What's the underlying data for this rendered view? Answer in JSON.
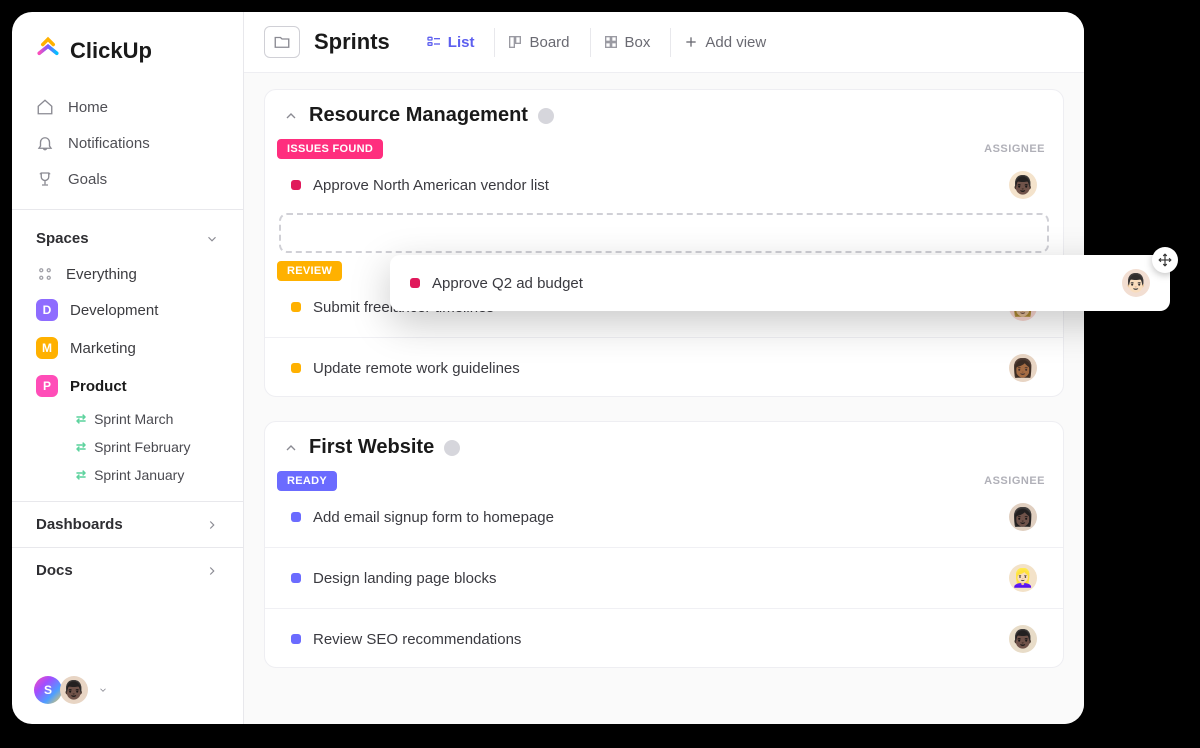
{
  "brand": {
    "name": "ClickUp"
  },
  "nav": {
    "home": "Home",
    "notifications": "Notifications",
    "goals": "Goals"
  },
  "spaces": {
    "header": "Spaces",
    "everything": "Everything",
    "items": [
      {
        "letter": "D",
        "label": "Development",
        "color": "#8e6cff"
      },
      {
        "letter": "M",
        "label": "Marketing",
        "color": "#ffb100"
      },
      {
        "letter": "P",
        "label": "Product",
        "color": "#ff4db8"
      }
    ],
    "sprints": [
      "Sprint  March",
      "Sprint  February",
      "Sprint January"
    ]
  },
  "footer_nav": {
    "dashboards": "Dashboards",
    "docs": "Docs"
  },
  "user": {
    "initial": "S"
  },
  "header": {
    "title": "Sprints",
    "views": {
      "list": "List",
      "board": "Board",
      "box": "Box",
      "add": "Add view"
    }
  },
  "lists": [
    {
      "title": "Resource Management",
      "assignee_label": "ASSIGNEE",
      "groups": [
        {
          "status": "ISSUES FOUND",
          "color": "#ff2e7e",
          "dot": "#e0195b",
          "tasks": [
            {
              "title": "Approve North American vendor list",
              "avatar_bg": "#f4e3cc",
              "avatar_face": "👨🏿"
            }
          ]
        },
        {
          "status": "REVIEW",
          "color": "#ffb100",
          "dot": "#ffb100",
          "tasks": [
            {
              "title": "Submit freelancer timelines",
              "avatar_bg": "#f8d6d0",
              "avatar_face": "👩🏼"
            },
            {
              "title": "Update remote work guidelines",
              "avatar_bg": "#e8d5c4",
              "avatar_face": "👩🏾"
            }
          ]
        }
      ]
    },
    {
      "title": "First Website",
      "assignee_label": "ASSIGNEE",
      "groups": [
        {
          "status": "READY",
          "color": "#6b6bff",
          "dot": "#6b6bff",
          "tasks": [
            {
              "title": "Add email signup form to homepage",
              "avatar_bg": "#e0cfc0",
              "avatar_face": "👩🏿"
            },
            {
              "title": "Design landing page blocks",
              "avatar_bg": "#f3e2c8",
              "avatar_face": "👱🏻‍♀️"
            },
            {
              "title": "Review SEO recommendations",
              "avatar_bg": "#e8dcc8",
              "avatar_face": "👨🏿"
            }
          ]
        }
      ]
    }
  ],
  "dragging": {
    "dot": "#e0195b",
    "title": "Approve Q2 ad budget",
    "avatar_bg": "#f2ded2",
    "avatar_face": "👨🏻"
  }
}
